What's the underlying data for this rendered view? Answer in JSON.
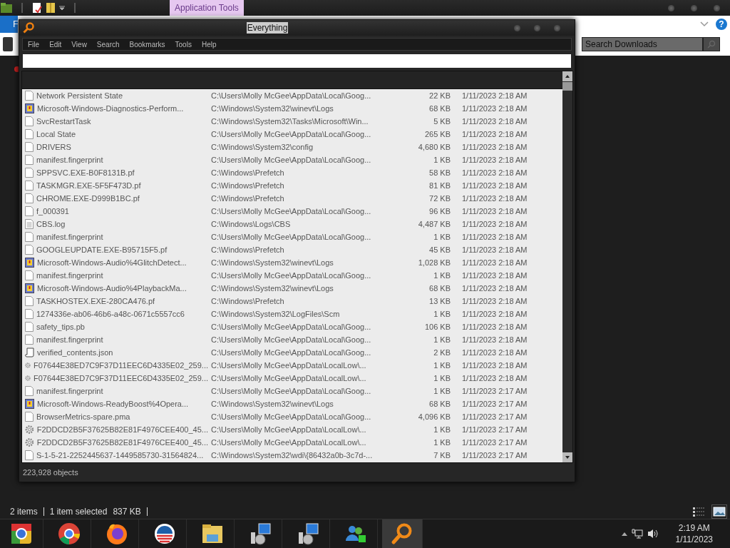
{
  "explorer": {
    "ribbon_context_tab": "Application Tools",
    "file_tab": "F",
    "help_button": "?",
    "search": {
      "placeholder": "Search Downloads"
    },
    "status": {
      "items": "2 items",
      "selection": "1 item selected",
      "size": "837 KB"
    }
  },
  "everything": {
    "title": "Everything",
    "menu": [
      "File",
      "Edit",
      "View",
      "Search",
      "Bookmarks",
      "Tools",
      "Help"
    ],
    "rows": [
      {
        "kind": "file",
        "name": "Network Persistent State",
        "path": "C:\\Users\\Molly McGee\\AppData\\Local\\Goog...",
        "size": "22 KB",
        "modified": "1/11/2023 2:18 AM"
      },
      {
        "kind": "event-log",
        "name": "Microsoft-Windows-Diagnostics-Perform...",
        "path": "C:\\Windows\\System32\\winevt\\Logs",
        "size": "68 KB",
        "modified": "1/11/2023 2:18 AM"
      },
      {
        "kind": "file",
        "name": "SvcRestartTask",
        "path": "C:\\Windows\\System32\\Tasks\\Microsoft\\Win...",
        "size": "5 KB",
        "modified": "1/11/2023 2:18 AM"
      },
      {
        "kind": "file",
        "name": "Local State",
        "path": "C:\\Users\\Molly McGee\\AppData\\Local\\Goog...",
        "size": "265 KB",
        "modified": "1/11/2023 2:18 AM"
      },
      {
        "kind": "file",
        "name": "DRIVERS",
        "path": "C:\\Windows\\System32\\config",
        "size": "4,680 KB",
        "modified": "1/11/2023 2:18 AM"
      },
      {
        "kind": "file",
        "name": "manifest.fingerprint",
        "path": "C:\\Users\\Molly McGee\\AppData\\Local\\Goog...",
        "size": "1 KB",
        "modified": "1/11/2023 2:18 AM"
      },
      {
        "kind": "file",
        "name": "SPPSVC.EXE-B0F8131B.pf",
        "path": "C:\\Windows\\Prefetch",
        "size": "58 KB",
        "modified": "1/11/2023 2:18 AM"
      },
      {
        "kind": "file",
        "name": "TASKMGR.EXE-5F5F473D.pf",
        "path": "C:\\Windows\\Prefetch",
        "size": "81 KB",
        "modified": "1/11/2023 2:18 AM"
      },
      {
        "kind": "file",
        "name": "CHROME.EXE-D999B1BC.pf",
        "path": "C:\\Windows\\Prefetch",
        "size": "72 KB",
        "modified": "1/11/2023 2:18 AM"
      },
      {
        "kind": "file",
        "name": "f_000391",
        "path": "C:\\Users\\Molly McGee\\AppData\\Local\\Goog...",
        "size": "96 KB",
        "modified": "1/11/2023 2:18 AM"
      },
      {
        "kind": "text",
        "name": "CBS.log",
        "path": "C:\\Windows\\Logs\\CBS",
        "size": "4,487 KB",
        "modified": "1/11/2023 2:18 AM"
      },
      {
        "kind": "file",
        "name": "manifest.fingerprint",
        "path": "C:\\Users\\Molly McGee\\AppData\\Local\\Goog...",
        "size": "1 KB",
        "modified": "1/11/2023 2:18 AM"
      },
      {
        "kind": "file",
        "name": "GOOGLEUPDATE.EXE-B95715F5.pf",
        "path": "C:\\Windows\\Prefetch",
        "size": "45 KB",
        "modified": "1/11/2023 2:18 AM"
      },
      {
        "kind": "event-log",
        "name": "Microsoft-Windows-Audio%4GlitchDetect...",
        "path": "C:\\Windows\\System32\\winevt\\Logs",
        "size": "1,028 KB",
        "modified": "1/11/2023 2:18 AM"
      },
      {
        "kind": "file",
        "name": "manifest.fingerprint",
        "path": "C:\\Users\\Molly McGee\\AppData\\Local\\Goog...",
        "size": "1 KB",
        "modified": "1/11/2023 2:18 AM"
      },
      {
        "kind": "event-log",
        "name": "Microsoft-Windows-Audio%4PlaybackMa...",
        "path": "C:\\Windows\\System32\\winevt\\Logs",
        "size": "68 KB",
        "modified": "1/11/2023 2:18 AM"
      },
      {
        "kind": "file",
        "name": "TASKHOSTEX.EXE-280CA476.pf",
        "path": "C:\\Windows\\Prefetch",
        "size": "13 KB",
        "modified": "1/11/2023 2:18 AM"
      },
      {
        "kind": "file",
        "name": "1274336e-ab06-46b6-a48c-0671c5557cc6",
        "path": "C:\\Windows\\System32\\LogFiles\\Scm",
        "size": "1 KB",
        "modified": "1/11/2023 2:18 AM"
      },
      {
        "kind": "file",
        "name": "safety_tips.pb",
        "path": "C:\\Users\\Molly McGee\\AppData\\Local\\Goog...",
        "size": "106 KB",
        "modified": "1/11/2023 2:18 AM"
      },
      {
        "kind": "file",
        "name": "manifest.fingerprint",
        "path": "C:\\Users\\Molly McGee\\AppData\\Local\\Goog...",
        "size": "1 KB",
        "modified": "1/11/2023 2:18 AM"
      },
      {
        "kind": "script",
        "name": "verified_contents.json",
        "path": "C:\\Users\\Molly McGee\\AppData\\Local\\Goog...",
        "size": "2 KB",
        "modified": "1/11/2023 2:18 AM"
      },
      {
        "kind": "gear",
        "name": "F07644E38ED7C9F37D11EEC6D4335E02_259...",
        "path": "C:\\Users\\Molly McGee\\AppData\\LocalLow\\...",
        "size": "1 KB",
        "modified": "1/11/2023 2:18 AM"
      },
      {
        "kind": "gear",
        "name": "F07644E38ED7C9F37D11EEC6D4335E02_259...",
        "path": "C:\\Users\\Molly McGee\\AppData\\LocalLow\\...",
        "size": "1 KB",
        "modified": "1/11/2023 2:18 AM"
      },
      {
        "kind": "file",
        "name": "manifest.fingerprint",
        "path": "C:\\Users\\Molly McGee\\AppData\\Local\\Goog...",
        "size": "1 KB",
        "modified": "1/11/2023 2:17 AM"
      },
      {
        "kind": "event-log",
        "name": "Microsoft-Windows-ReadyBoost%4Opera...",
        "path": "C:\\Windows\\System32\\winevt\\Logs",
        "size": "68 KB",
        "modified": "1/11/2023 2:17 AM"
      },
      {
        "kind": "file",
        "name": "BrowserMetrics-spare.pma",
        "path": "C:\\Users\\Molly McGee\\AppData\\Local\\Goog...",
        "size": "4,096 KB",
        "modified": "1/11/2023 2:17 AM"
      },
      {
        "kind": "gear",
        "name": "F2DDCD2B5F37625B82E81F4976CEE400_45...",
        "path": "C:\\Users\\Molly McGee\\AppData\\LocalLow\\...",
        "size": "1 KB",
        "modified": "1/11/2023 2:17 AM"
      },
      {
        "kind": "gear",
        "name": "F2DDCD2B5F37625B82E81F4976CEE400_45...",
        "path": "C:\\Users\\Molly McGee\\AppData\\LocalLow\\...",
        "size": "1 KB",
        "modified": "1/11/2023 2:17 AM"
      },
      {
        "kind": "file",
        "name": "S-1-5-21-2252445637-1449585730-31564824...",
        "path": "C:\\Windows\\System32\\wdi\\{86432a0b-3c7d-...",
        "size": "7 KB",
        "modified": "1/11/2023 2:17 AM"
      }
    ],
    "status": "223,928 objects"
  },
  "taskbar": {
    "time": "2:19 AM",
    "date": "1/11/2023"
  }
}
